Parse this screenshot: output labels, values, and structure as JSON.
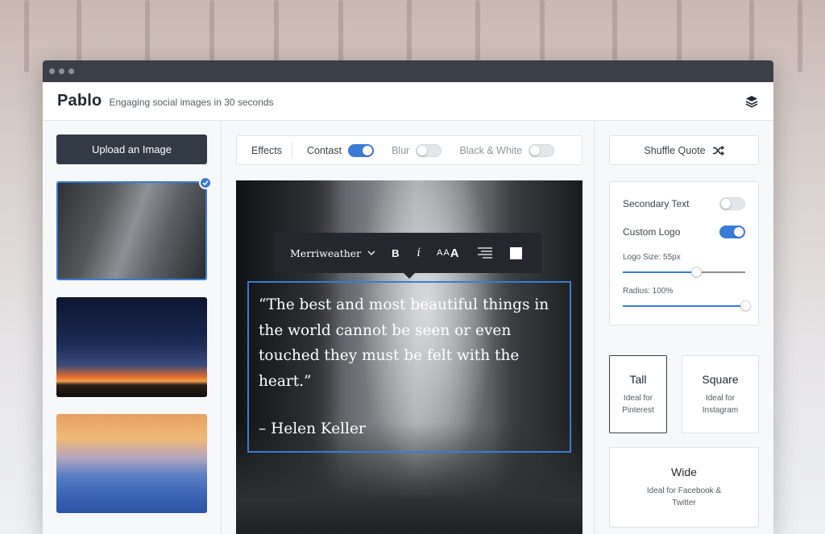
{
  "header": {
    "brand": "Pablo",
    "tagline": "Engaging social images in 30 seconds"
  },
  "sidebar_left": {
    "upload_label": "Upload an Image"
  },
  "toolbar": {
    "effects_label": "Effects",
    "contrast_label": "Contast",
    "contrast_on": true,
    "blur_label": "Blur",
    "blur_on": false,
    "bw_label": "Black & White",
    "bw_on": false
  },
  "format_bar": {
    "font_name": "Merriweather",
    "bold_label": "B",
    "italic_label": "i",
    "size_small": "AA",
    "size_large": "A"
  },
  "quote": {
    "text": "“The best and most beautiful things in the world cannot be seen or even touched they must be felt with the heart.”",
    "author": "– Helen Keller"
  },
  "sidebar_right": {
    "shuffle_label": "Shuffle Quote",
    "secondary_text_label": "Secondary Text",
    "secondary_text_on": false,
    "custom_logo_label": "Custom Logo",
    "custom_logo_on": true,
    "logo_size_label": "Logo Size: 55px",
    "logo_size_fraction": 0.6,
    "radius_label": "Radius: 100%",
    "radius_fraction": 1.0,
    "sizes": {
      "tall": {
        "title": "Tall",
        "desc": "Ideal for Pinterest"
      },
      "square": {
        "title": "Square",
        "desc": "Ideal for Instagram"
      },
      "wide": {
        "title": "Wide",
        "desc": "Ideal for Facebook & Twitter"
      }
    }
  },
  "colors": {
    "accent": "#3a7bd5",
    "dark": "#323a45"
  }
}
